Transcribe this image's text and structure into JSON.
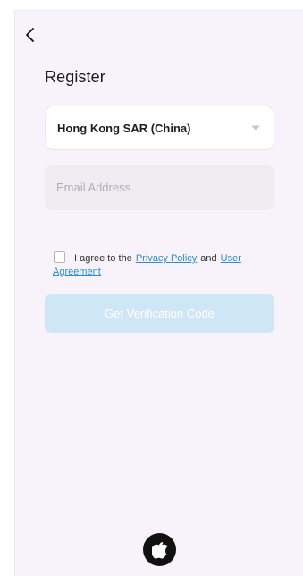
{
  "header": {
    "back_icon": "chevron-left-icon"
  },
  "page": {
    "title": "Register"
  },
  "region": {
    "value": "Hong Kong SAR (China)",
    "icon": "caret-down-icon"
  },
  "email": {
    "placeholder": "Email Address",
    "value": ""
  },
  "agreement": {
    "prefix": "I agree to the",
    "privacy_link": "Privacy Policy",
    "conjunction": "and",
    "user_agreement_link_part1": "User",
    "user_agreement_link_part2": "Agreement",
    "checked": false
  },
  "actions": {
    "verify_label": "Get Verification Code",
    "verify_enabled": false
  },
  "social": {
    "apple_icon": "apple-icon"
  },
  "colors": {
    "screen_bg": "#f8f3fa",
    "link": "#2a8ad6",
    "button_disabled": "#cfe6f7",
    "apple_bg": "#111111"
  }
}
